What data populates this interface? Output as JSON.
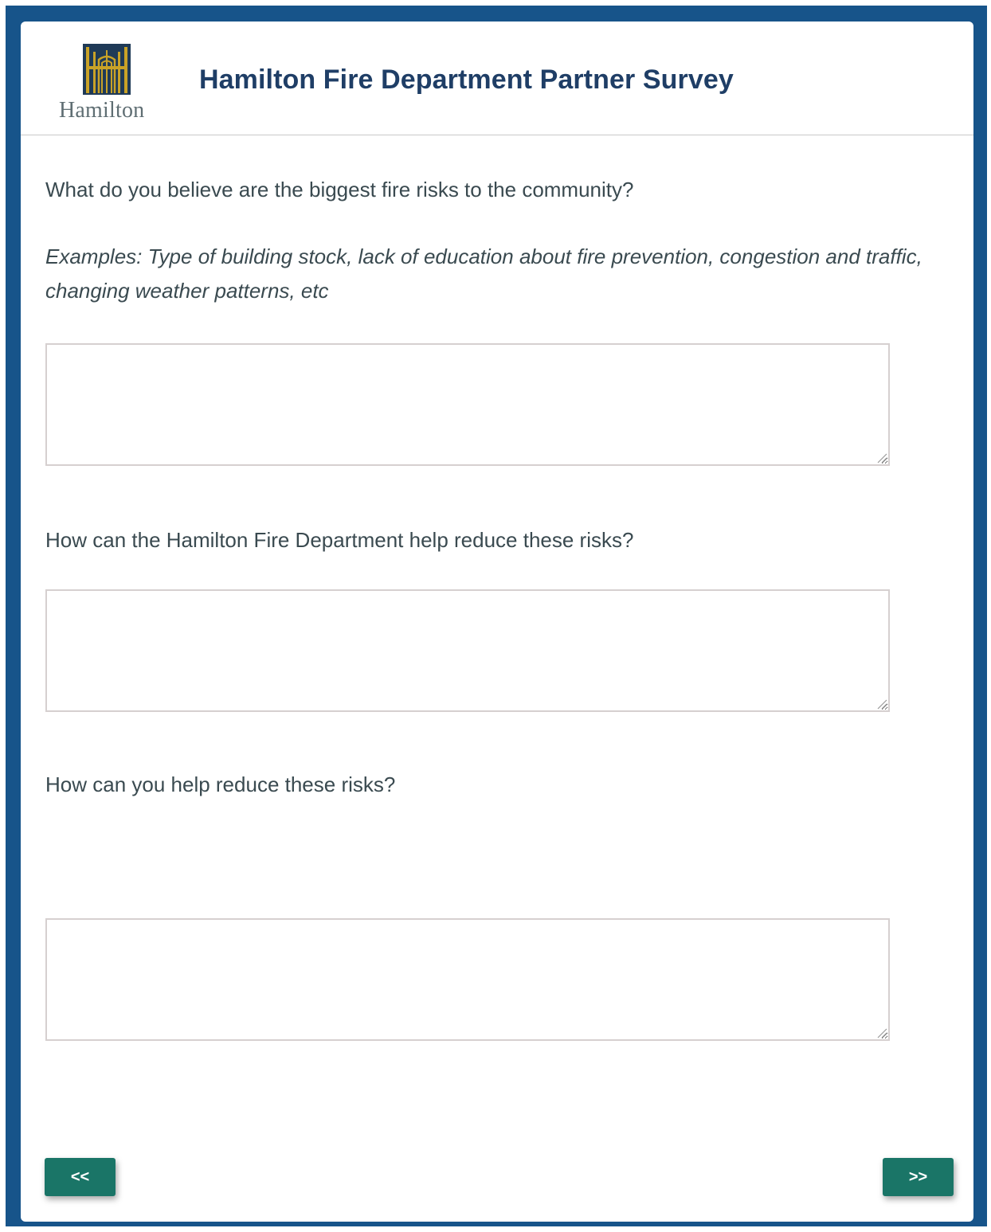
{
  "header": {
    "logo_text": "Hamilton",
    "title": "Hamilton Fire Department Partner Survey"
  },
  "questions": [
    {
      "label": "What do you believe are the biggest fire risks to the community?",
      "hint": "Examples: Type of building stock, lack of education about fire prevention, congestion and traffic, changing weather patterns, etc",
      "value": ""
    },
    {
      "label": "How can the Hamilton Fire Department help reduce these risks?",
      "value": ""
    },
    {
      "label": "How can you help reduce these risks?",
      "value": ""
    }
  ],
  "nav": {
    "prev_label": "<<",
    "next_label": ">>"
  },
  "colors": {
    "frame": "#17548a",
    "title": "#1f3e66",
    "button": "#1a7567",
    "logo_gold": "#c9a227",
    "logo_navy": "#1f3a57"
  },
  "icons": {
    "logo": "hamilton-logo-icon",
    "resize": "resize-grip-icon"
  }
}
